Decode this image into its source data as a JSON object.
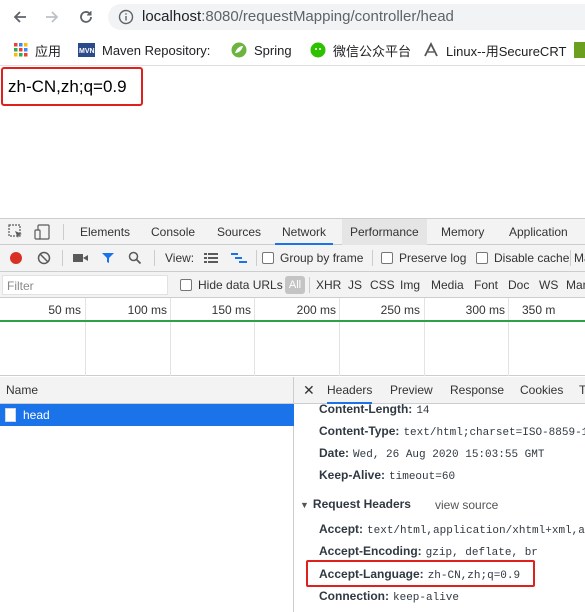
{
  "browser": {
    "url_host": "localhost",
    "url_path": ":8080/requestMapping/controller/head",
    "bookmarks": [
      {
        "label": "应用",
        "icon": "apps-grid-icon"
      },
      {
        "label": "Maven Repository: S",
        "icon": "mvn-icon"
      },
      {
        "label": "Spring",
        "icon": "spring-leaf-icon"
      },
      {
        "label": "微信公众平台",
        "icon": "wechat-icon"
      },
      {
        "label": "Linux--用SecureCRT",
        "icon": "secure-icon"
      }
    ]
  },
  "page": {
    "response_text": "zh-CN,zh;q=0.9"
  },
  "devtools": {
    "tabs": [
      "Elements",
      "Console",
      "Sources",
      "Network",
      "Performance",
      "Memory",
      "Application"
    ],
    "active_tab": "Network",
    "toolbar": {
      "view_label": "View:",
      "group_by_frame": "Group by frame",
      "preserve_log": "Preserve log",
      "disable_cache": "Disable cache",
      "overflow": "Ma"
    },
    "filter": {
      "placeholder": "Filter",
      "hide_data_urls": "Hide data URLs",
      "types": [
        "All",
        "XHR",
        "JS",
        "CSS",
        "Img",
        "Media",
        "Font",
        "Doc",
        "WS",
        "Man"
      ]
    },
    "timeline_ticks": [
      "50 ms",
      "100 ms",
      "150 ms",
      "200 ms",
      "250 ms",
      "300 ms",
      "350 m"
    ],
    "name_header": "Name",
    "requests": [
      {
        "name": "head"
      }
    ],
    "detail_tabs": [
      "Headers",
      "Preview",
      "Response",
      "Cookies",
      "T"
    ],
    "response_headers": [
      {
        "key": "Content-Length:",
        "value": "14"
      },
      {
        "key": "Content-Type:",
        "value": "text/html;charset=ISO-8859-1"
      },
      {
        "key": "Date:",
        "value": "Wed, 26 Aug 2020 15:03:55 GMT"
      },
      {
        "key": "Keep-Alive:",
        "value": "timeout=60"
      }
    ],
    "request_headers_title": "Request Headers",
    "view_source": "view source",
    "request_headers": [
      {
        "key": "Accept:",
        "value": "text/html,application/xhtml+xml,a"
      },
      {
        "key": "Accept-Encoding:",
        "value": "gzip, deflate, br"
      },
      {
        "key": "Accept-Language:",
        "value": "zh-CN,zh;q=0.9"
      },
      {
        "key": "Connection:",
        "value": "keep-alive"
      }
    ]
  }
}
